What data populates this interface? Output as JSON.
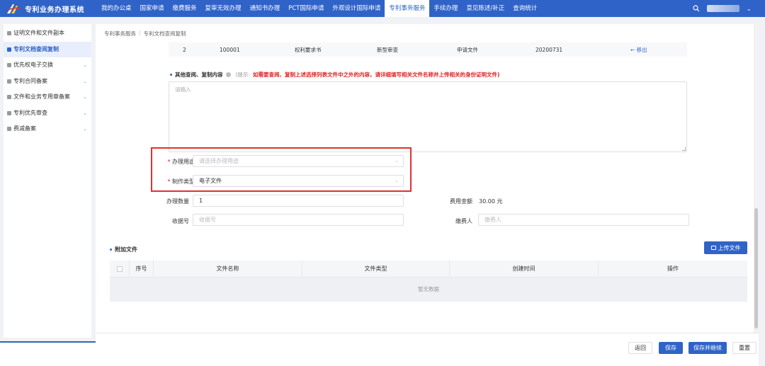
{
  "app": {
    "title": "专利业务办理系统",
    "logo_icon": "logo-icon"
  },
  "nav": {
    "items": [
      {
        "label": "我的办公桌"
      },
      {
        "label": "国家申请"
      },
      {
        "label": "缴费服务"
      },
      {
        "label": "复审无效办理"
      },
      {
        "label": "通知书办理"
      },
      {
        "label": "PCT国际申请"
      },
      {
        "label": "外观设计国际申请"
      },
      {
        "label": "专利事务服务",
        "active": true
      },
      {
        "label": "手续办理"
      },
      {
        "label": "意见陈述/补正"
      },
      {
        "label": "查询统计"
      }
    ],
    "accent_color": "#2f63c8"
  },
  "sidebar": {
    "items": [
      {
        "label": "证明文件和文件副本",
        "icon": "certificate-icon"
      },
      {
        "label": "专利文档查阅复制",
        "icon": "document-icon",
        "active": true
      },
      {
        "label": "优先权电子交换",
        "icon": "list-icon",
        "chevron": true
      },
      {
        "label": "专利合同备案",
        "icon": "list-icon",
        "chevron": true
      },
      {
        "label": "文件和业务专用章备案",
        "icon": "stamp-icon",
        "chevron": true
      },
      {
        "label": "专利优先审查",
        "icon": "list-icon",
        "chevron": true
      },
      {
        "label": "费减备案",
        "icon": "gear-icon",
        "chevron": true
      }
    ]
  },
  "breadcrumb": {
    "parent": "专利事务服务",
    "separator": "/",
    "current": "专利文档查阅复制"
  },
  "previous_row": {
    "index": "2",
    "number": "100001",
    "doc_name": "权利要求书",
    "stage": "新型审查",
    "category": "申请文件",
    "date": "20200731",
    "action": "← 移出"
  },
  "other_content": {
    "label": "其他查阅、复制内容",
    "hint_prefix": "(提示:",
    "hint_body": "如需要查阅、复制上述选择列表文件中之外的内容，请详细填写相关文件名称并上传相关的身份证明文件)",
    "placeholder": "请输入"
  },
  "form": {
    "usage": {
      "label": "办理用途",
      "placeholder": "请选择办理用途",
      "required": true
    },
    "make_type": {
      "label": "制作类型",
      "value": "电子文件",
      "required": true
    },
    "quantity": {
      "label": "办理数量",
      "value": "1"
    },
    "fee": {
      "label": "费用金额",
      "value": "30.00 元"
    },
    "receipt": {
      "label": "收据号",
      "placeholder": "收据号"
    },
    "payer": {
      "label": "缴费人",
      "placeholder": "缴费人"
    }
  },
  "attachments": {
    "title": "附加文件",
    "upload_label": "上传文件",
    "columns": [
      "序号",
      "文件名称",
      "文件类型",
      "创建时间",
      "操作"
    ],
    "empty_text": "暂无数据"
  },
  "footer": {
    "back": "返回",
    "save": "保存",
    "save_continue": "保存并继续",
    "reset": "重置"
  }
}
